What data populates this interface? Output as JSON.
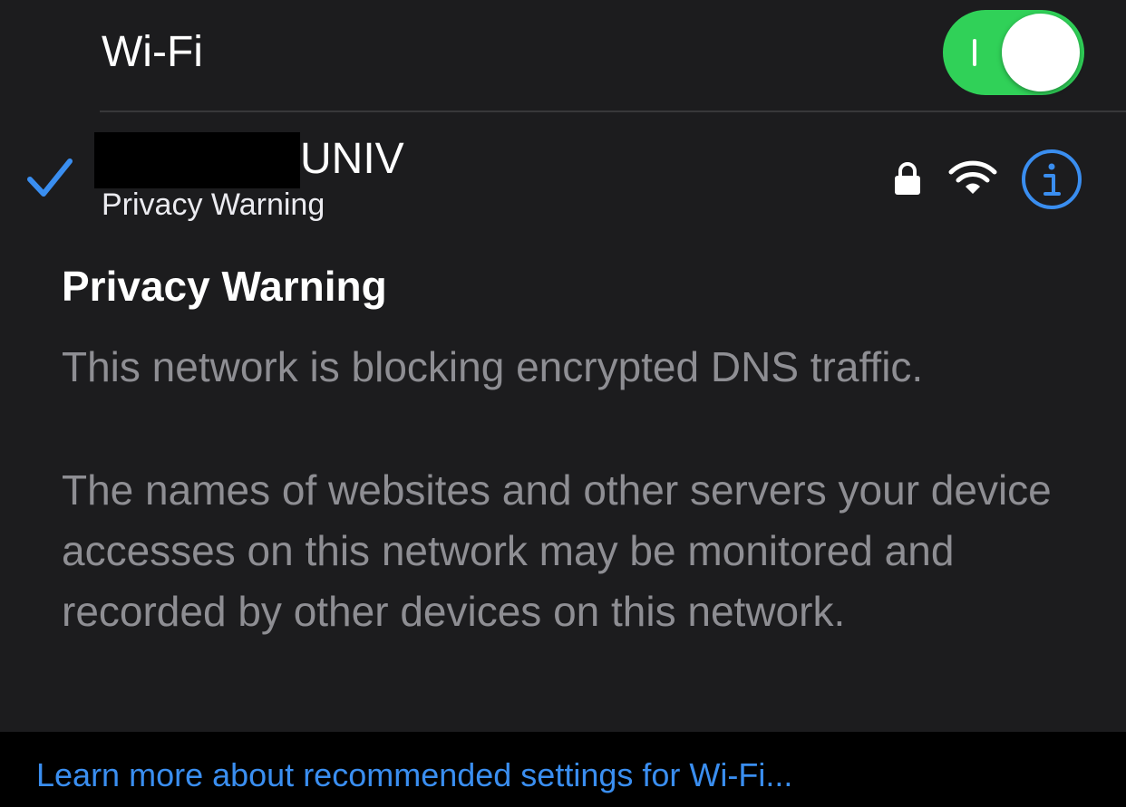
{
  "wifi": {
    "label": "Wi-Fi",
    "enabled": true,
    "toggle_color": "#30d158"
  },
  "network": {
    "name_suffix": "UNIV",
    "subtitle": "Privacy Warning",
    "connected": true,
    "secured": true,
    "icons": [
      "checkmark-icon",
      "lock-icon",
      "wifi-signal-icon",
      "info-icon"
    ]
  },
  "warning": {
    "title": "Privacy Warning",
    "line1": "This network is blocking encrypted DNS traffic.",
    "body": "The names of websites and other servers your device accesses on this network may be monitored and recorded by other devices on this network."
  },
  "footer": {
    "link_text": "Learn more about recommended settings for Wi-Fi..."
  },
  "colors": {
    "accent": "#3a8ef0",
    "background": "#1c1c1e",
    "secondary_text": "#8e8e93"
  }
}
